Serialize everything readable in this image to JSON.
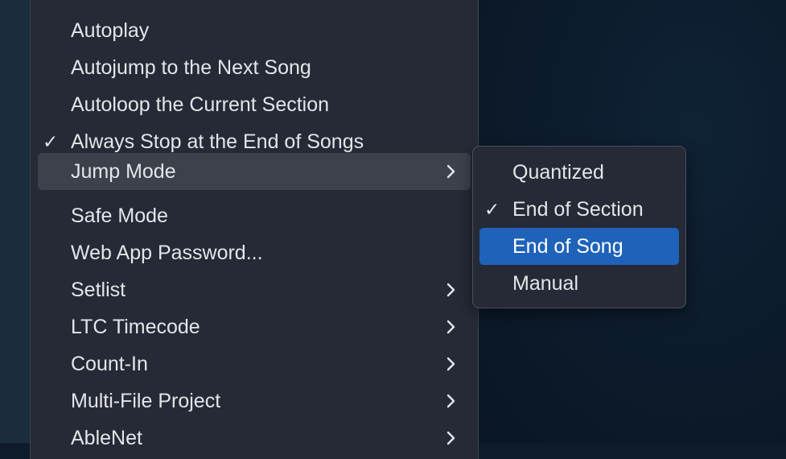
{
  "main_menu": {
    "items": [
      {
        "label": "Autoplay"
      },
      {
        "label": "Autojump to the Next Song"
      },
      {
        "label": "Autoloop the Current Section"
      },
      {
        "label": "Always Stop at the End of Songs",
        "check": "✓"
      },
      {
        "label": "Jump Mode",
        "submenu_icon": "chevron-right-icon"
      },
      {
        "label": "Safe Mode"
      },
      {
        "label": "Web App Password..."
      },
      {
        "label": "Setlist",
        "submenu_icon": "chevron-right-icon"
      },
      {
        "label": "LTC Timecode",
        "submenu_icon": "chevron-right-icon"
      },
      {
        "label": "Count-In",
        "submenu_icon": "chevron-right-icon"
      },
      {
        "label": "Multi-File Project",
        "submenu_icon": "chevron-right-icon"
      },
      {
        "label": "AbleNet",
        "submenu_icon": "chevron-right-icon"
      }
    ],
    "highlighted_item": "Jump Mode"
  },
  "jump_mode_submenu": {
    "items": [
      {
        "label": "Quantized"
      },
      {
        "label": "End of Section",
        "check": "✓"
      },
      {
        "label": "End of Song"
      },
      {
        "label": "Manual"
      }
    ],
    "selected_item": "End of Song"
  },
  "colors": {
    "menu_background": "#262a36",
    "highlight": "#3c414c",
    "selection_accent": "#1f62b9",
    "text": "#e4e5e9"
  }
}
